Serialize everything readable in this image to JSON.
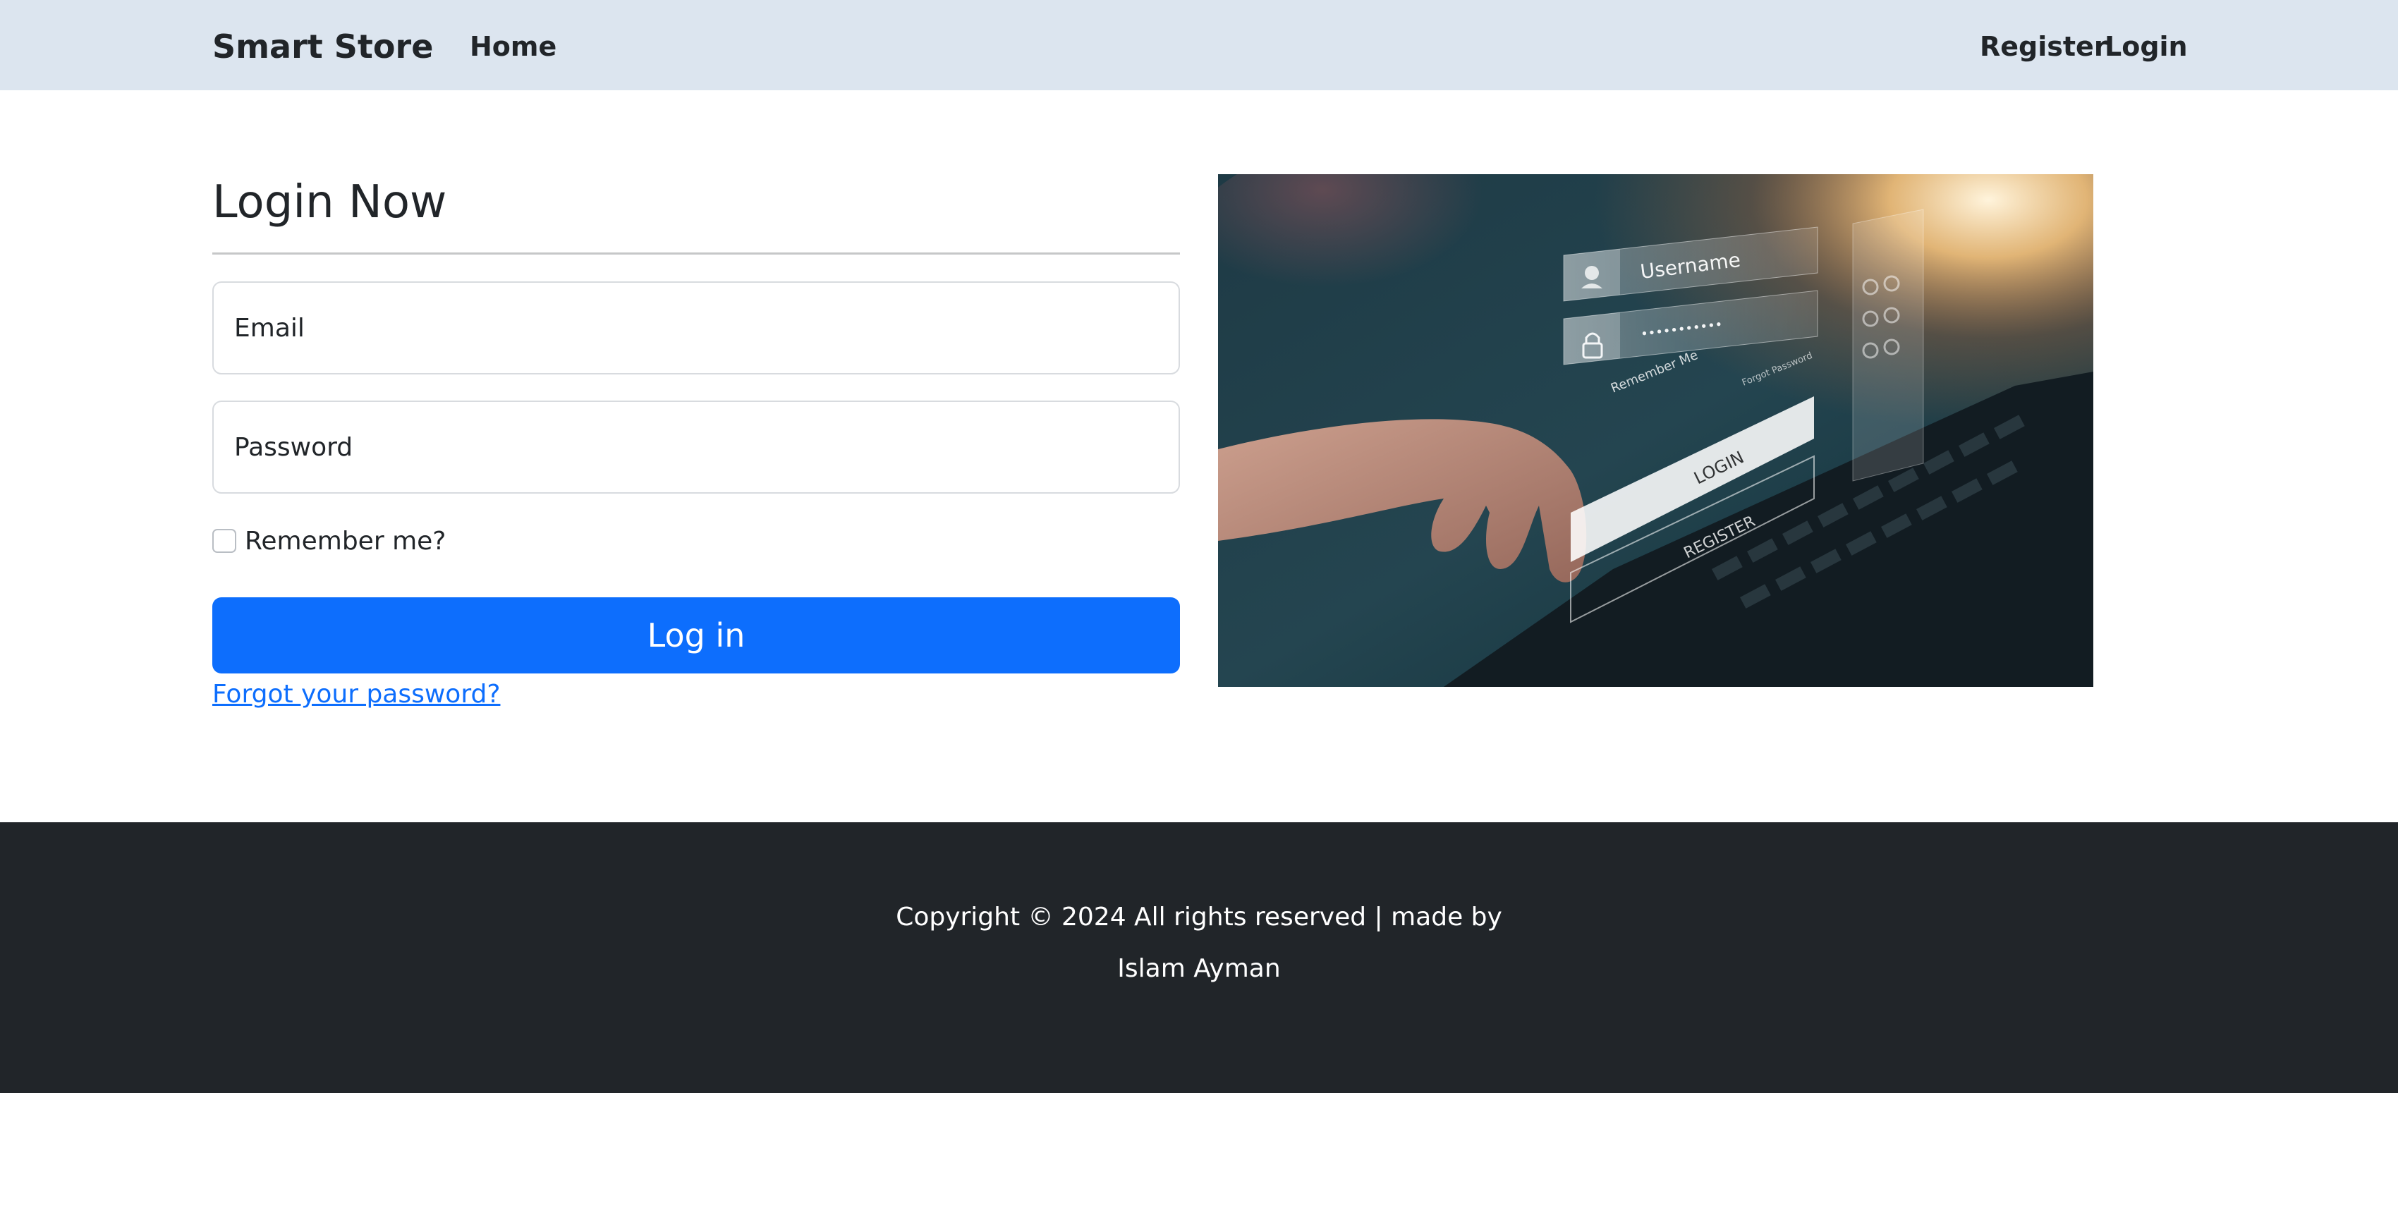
{
  "navbar": {
    "brand": "Smart Store",
    "home": "Home",
    "register": "Register",
    "login": "Login"
  },
  "login": {
    "title": "Login Now",
    "email_placeholder": "Email",
    "password_placeholder": "Password",
    "remember_label": "Remember me?",
    "remember_checked": false,
    "submit_label": "Log in",
    "forgot_link": "Forgot your password?"
  },
  "hero_image": {
    "username_text": "Username",
    "password_mask": "•••••••••••",
    "remember_text": "Remember Me",
    "forgot_text": "Forgot Password",
    "login_text": "LOGIN",
    "register_text": "REGISTER"
  },
  "footer": {
    "copyright": "Copyright © 2024 All rights reserved | made by",
    "author": "Islam Ayman"
  },
  "colors": {
    "navbar_bg": "#dce5ef",
    "primary": "#0d6efd",
    "footer_bg": "#212529",
    "text": "#212529"
  }
}
